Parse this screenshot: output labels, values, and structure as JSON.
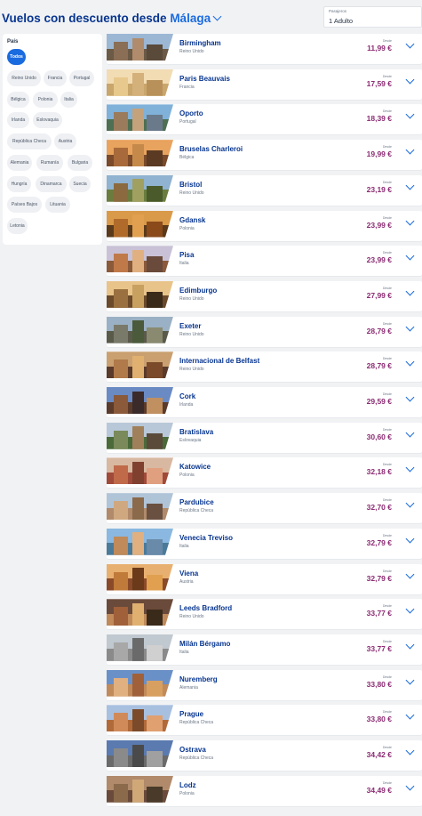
{
  "header": {
    "title_prefix": "Vuelos con descuento desde",
    "origin": "Málaga",
    "passengers_label": "Pasajeros",
    "passengers_value": "1 Adulto"
  },
  "filters": {
    "title": "País",
    "chips": [
      "Todos",
      "Reino Unido",
      "Francia",
      "Portugal",
      "Bélgica",
      "Polonia",
      "Italia",
      "Irlanda",
      "Eslovaquia",
      "República Checa",
      "Austria",
      "Alemania",
      "Rumanía",
      "Bulgaria",
      "Hungría",
      "Dinamarca",
      "Suecia",
      "Países Bajos",
      "Lituania",
      "Letonia"
    ],
    "active": "Todos"
  },
  "colors": {
    "brand": "#073590",
    "accent": "#1a6bdf",
    "price": "#8c2b73"
  },
  "flights": [
    {
      "city": "Birmingham",
      "country": "Reino Unido",
      "from": "Desde",
      "price": "11,99 €"
    },
    {
      "city": "Paris Beauvais",
      "country": "Francia",
      "from": "Desde",
      "price": "17,59 €"
    },
    {
      "city": "Oporto",
      "country": "Portugal",
      "from": "Desde",
      "price": "18,39 €"
    },
    {
      "city": "Bruselas Charleroi",
      "country": "Bélgica",
      "from": "Desde",
      "price": "19,99 €"
    },
    {
      "city": "Bristol",
      "country": "Reino Unido",
      "from": "Desde",
      "price": "23,19 €"
    },
    {
      "city": "Gdansk",
      "country": "Polonia",
      "from": "Desde",
      "price": "23,99 €"
    },
    {
      "city": "Pisa",
      "country": "Italia",
      "from": "Desde",
      "price": "23,99 €"
    },
    {
      "city": "Edimburgo",
      "country": "Reino Unido",
      "from": "Desde",
      "price": "27,99 €"
    },
    {
      "city": "Exeter",
      "country": "Reino Unido",
      "from": "Desde",
      "price": "28,79 €"
    },
    {
      "city": "Internacional de Belfast",
      "country": "Reino Unido",
      "from": "Desde",
      "price": "28,79 €"
    },
    {
      "city": "Cork",
      "country": "Irlanda",
      "from": "Desde",
      "price": "29,59 €"
    },
    {
      "city": "Bratislava",
      "country": "Eslovaquia",
      "from": "Desde",
      "price": "30,60 €"
    },
    {
      "city": "Katowice",
      "country": "Polonia",
      "from": "Desde",
      "price": "32,18 €"
    },
    {
      "city": "Pardubice",
      "country": "República Checa",
      "from": "Desde",
      "price": "32,70 €"
    },
    {
      "city": "Venecia Treviso",
      "country": "Italia",
      "from": "Desde",
      "price": "32,79 €"
    },
    {
      "city": "Viena",
      "country": "Austria",
      "from": "Desde",
      "price": "32,79 €"
    },
    {
      "city": "Leeds Bradford",
      "country": "Reino Unido",
      "from": "Desde",
      "price": "33,77 €"
    },
    {
      "city": "Milán Bérgamo",
      "country": "Italia",
      "from": "Desde",
      "price": "33,77 €"
    },
    {
      "city": "Nuremberg",
      "country": "Alemania",
      "from": "Desde",
      "price": "33,80 €"
    },
    {
      "city": "Prague",
      "country": "República Checa",
      "from": "Desde",
      "price": "33,80 €"
    },
    {
      "city": "Ostrava",
      "country": "República Checa",
      "from": "Desde",
      "price": "34,42 €"
    },
    {
      "city": "Lodz",
      "country": "Polonia",
      "from": "Desde",
      "price": "34,49 €"
    }
  ]
}
